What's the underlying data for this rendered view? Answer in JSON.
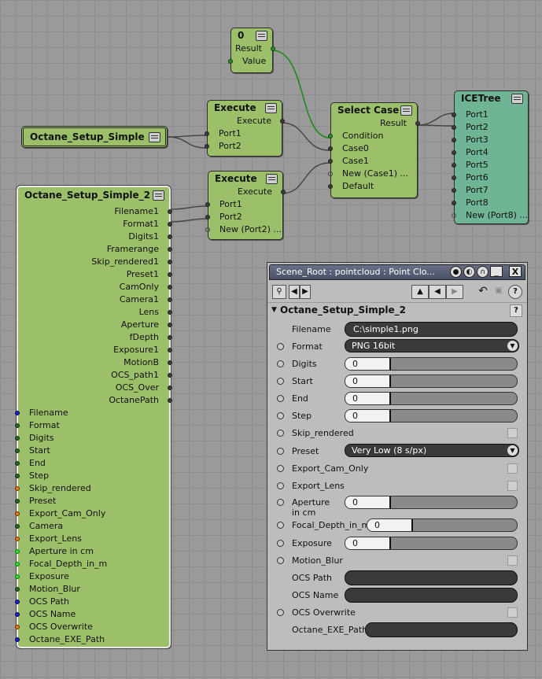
{
  "nodes": {
    "zero": {
      "title": "0",
      "outputs": [
        "Result"
      ],
      "inputs": [
        "Value"
      ]
    },
    "octane_setup": {
      "title": "Octane_Setup_Simple"
    },
    "execute1": {
      "title": "Execute",
      "outputs": [
        "Execute"
      ],
      "inputs": [
        "Port1",
        "Port2"
      ]
    },
    "execute2": {
      "title": "Execute",
      "outputs": [
        "Execute"
      ],
      "inputs": [
        "Port1",
        "Port2",
        "New (Port2) ..."
      ]
    },
    "select_case": {
      "title": "Select Case",
      "outputs": [
        "Result"
      ],
      "inputs": [
        "Condition",
        "Case0",
        "Case1",
        "New (Case1) ...",
        "Default"
      ]
    },
    "icetree": {
      "title": "ICETree",
      "inputs": [
        "Port1",
        "Port2",
        "Port3",
        "Port4",
        "Port5",
        "Port6",
        "Port7",
        "Port8",
        "New (Port8) ..."
      ]
    },
    "compound": {
      "title": "Octane_Setup_Simple_2",
      "outputs": [
        "Filename1",
        "Format1",
        "Digits1",
        "Framerange",
        "Skip_rendered1",
        "Preset1",
        "CamOnly",
        "Camera1",
        "Lens",
        "Aperture",
        "fDepth",
        "Exposure1",
        "MotionB",
        "OCS_path1",
        "OCS_Over",
        "OctanePath"
      ],
      "inputs": [
        "Filename",
        "Format",
        "Digits",
        "Start",
        "End",
        "Step",
        "Skip_rendered",
        "Preset",
        "Export_Cam_Only",
        "Camera",
        "Export_Lens",
        "Aperture in cm",
        "Focal_Depth_in_m",
        "Exposure",
        "Motion_Blur",
        "OCS Path",
        "OCS Name",
        "OCS Overwrite",
        "Octane_EXE_Path"
      ]
    }
  },
  "ppg": {
    "title": "Scene_Root : pointcloud : Point Clo...",
    "title_buttons": [
      "_",
      "X"
    ],
    "section": "Octane_Setup_Simple_2",
    "help": "?",
    "params": {
      "filename": {
        "label": "Filename",
        "value": "C:\\simple1.png"
      },
      "format": {
        "label": "Format",
        "value": "PNG 16bit"
      },
      "digits": {
        "label": "Digits",
        "value": "0"
      },
      "start": {
        "label": "Start",
        "value": "0"
      },
      "end": {
        "label": "End",
        "value": "0"
      },
      "step": {
        "label": "Step",
        "value": "0"
      },
      "skip_rendered": {
        "label": "Skip_rendered"
      },
      "preset": {
        "label": "Preset",
        "value": "Very Low (8 s/px)"
      },
      "export_cam_only": {
        "label": "Export_Cam_Only"
      },
      "export_lens": {
        "label": "Export_Lens"
      },
      "aperture": {
        "label": "Aperture in cm",
        "value": "0"
      },
      "focal_depth": {
        "label": "Focal_Depth_in_m",
        "value": "0"
      },
      "exposure": {
        "label": "Exposure",
        "value": "0"
      },
      "motion_blur": {
        "label": "Motion_Blur"
      },
      "ocs_path": {
        "label": "OCS Path",
        "value": ""
      },
      "ocs_name": {
        "label": "OCS Name",
        "value": ""
      },
      "ocs_overwrite": {
        "label": "OCS Overwrite"
      },
      "octane_exe_path": {
        "label": "Octane_EXE_Path",
        "value": ""
      }
    }
  },
  "colors": {
    "node_green": "#9cc06a",
    "node_teal": "#6fb494",
    "wire": "#444444",
    "wire_bool": "#1e8a1e"
  }
}
